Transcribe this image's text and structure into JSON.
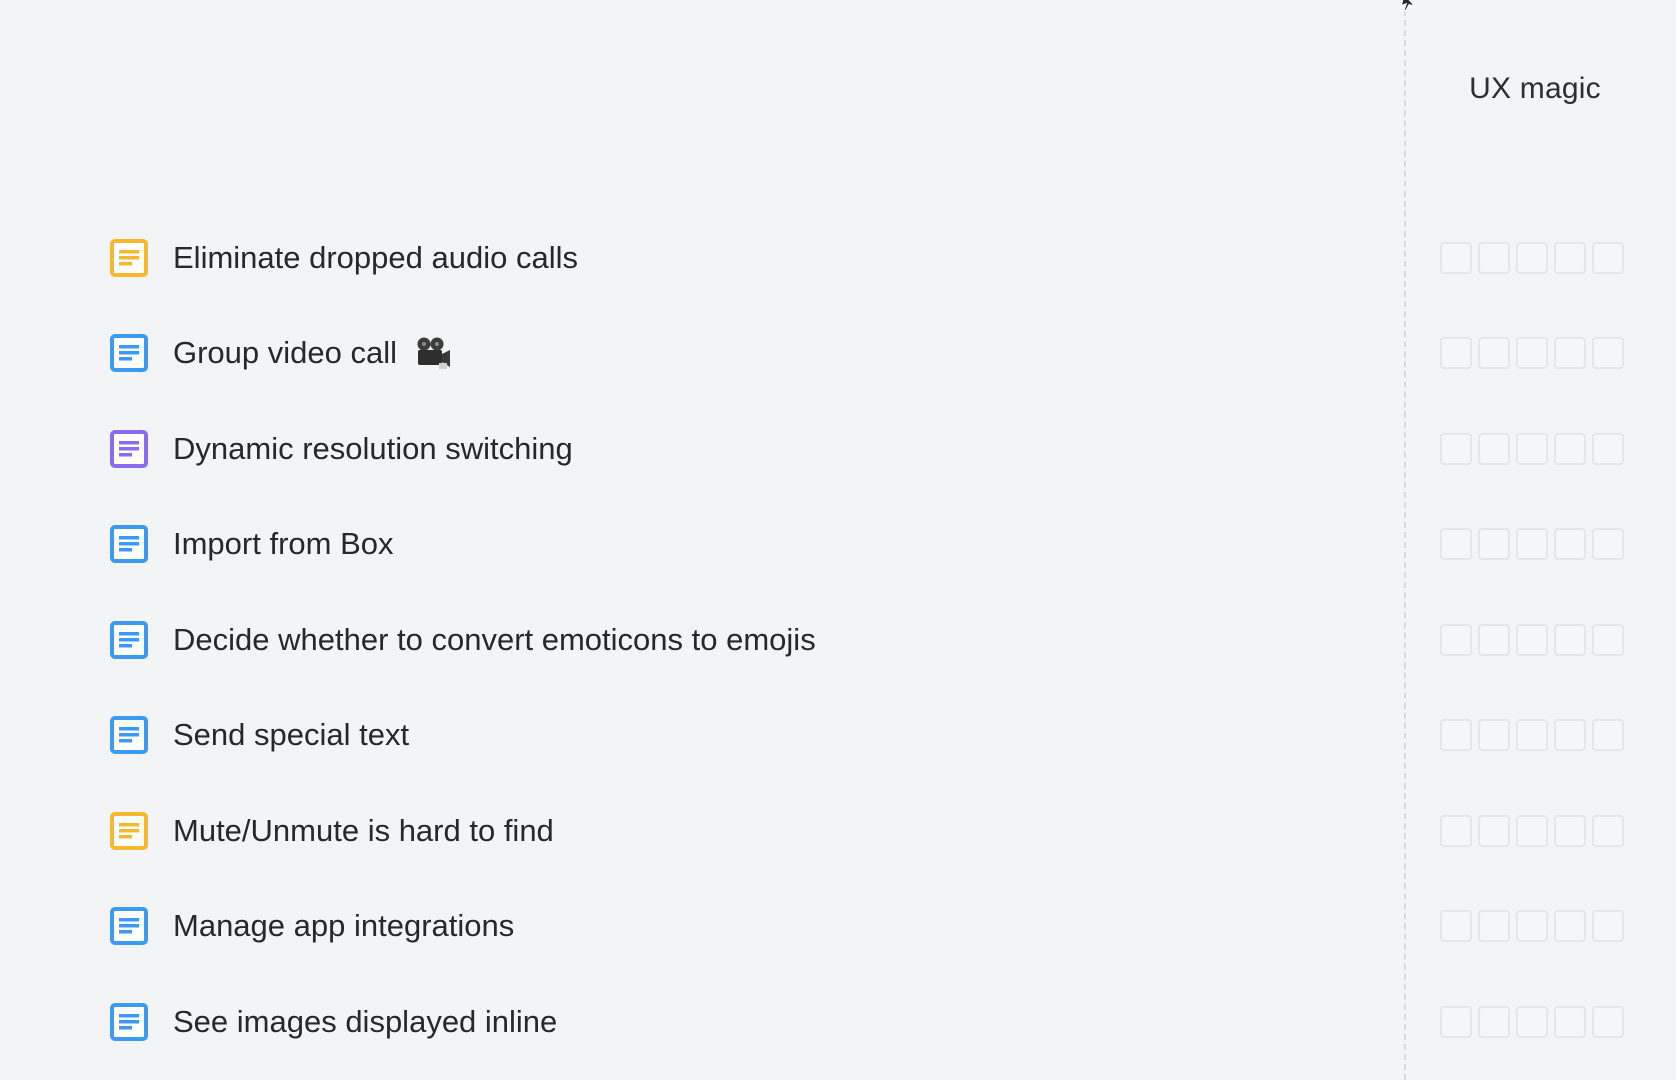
{
  "column": {
    "title": "UX magic"
  },
  "items": [
    {
      "label": "Eliminate dropped audio calls",
      "icon": "document-icon",
      "color": "#f5b82e",
      "emoji": ""
    },
    {
      "label": "Group video call",
      "icon": "document-icon",
      "color": "#3b9af2",
      "emoji": "movie-camera-icon"
    },
    {
      "label": "Dynamic resolution switching",
      "icon": "document-icon",
      "color": "#8b6cf0",
      "emoji": ""
    },
    {
      "label": "Import from Box",
      "icon": "document-icon",
      "color": "#3b9af2",
      "emoji": ""
    },
    {
      "label": "Decide whether to convert emoticons to emojis",
      "icon": "document-icon",
      "color": "#3b9af2",
      "emoji": ""
    },
    {
      "label": "Send special text",
      "icon": "document-icon",
      "color": "#3b9af2",
      "emoji": ""
    },
    {
      "label": "Mute/Unmute is hard to find",
      "icon": "document-icon",
      "color": "#f5b82e",
      "emoji": ""
    },
    {
      "label": "Manage app integrations",
      "icon": "document-icon",
      "color": "#3b9af2",
      "emoji": ""
    },
    {
      "label": "See images displayed inline",
      "icon": "document-icon",
      "color": "#3b9af2",
      "emoji": ""
    }
  ],
  "rating": {
    "scale": 5,
    "selected": [
      0,
      0,
      0,
      0,
      0,
      0,
      0,
      0,
      0
    ]
  }
}
